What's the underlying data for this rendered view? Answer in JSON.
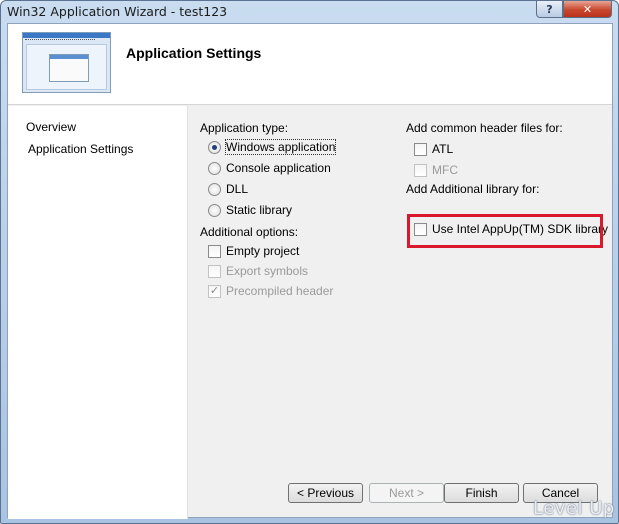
{
  "window": {
    "title": "Win32 Application Wizard - test123",
    "help_label": "?",
    "close_label": "✕"
  },
  "header": {
    "title": "Application Settings"
  },
  "nav": {
    "items": [
      {
        "label": "Overview"
      },
      {
        "label": "Application Settings"
      }
    ]
  },
  "app_type": {
    "heading": "Application type:",
    "options": [
      {
        "label": "Windows application",
        "selected": true
      },
      {
        "label": "Console application",
        "selected": false
      },
      {
        "label": "DLL",
        "selected": false
      },
      {
        "label": "Static library",
        "selected": false
      }
    ]
  },
  "additional_options": {
    "heading": "Additional options:",
    "options": [
      {
        "label": "Empty project",
        "checked": false,
        "enabled": true
      },
      {
        "label": "Export symbols",
        "checked": false,
        "enabled": false
      },
      {
        "label": "Precompiled header",
        "checked": true,
        "enabled": false
      }
    ]
  },
  "header_files": {
    "heading": "Add common header files for:",
    "options": [
      {
        "label": "ATL",
        "checked": false,
        "enabled": true
      },
      {
        "label": "MFC",
        "checked": false,
        "enabled": false
      }
    ]
  },
  "library": {
    "heading": "Add Additional library for:",
    "options": [
      {
        "label": "Use Intel AppUp(TM) SDK library",
        "checked": false,
        "enabled": true
      }
    ]
  },
  "buttons": {
    "previous": "< Previous",
    "next": "Next >",
    "finish": "Finish",
    "cancel": "Cancel"
  },
  "colors": {
    "highlight_box": "#d9182d",
    "window_frame": "#a9c3e2"
  },
  "watermark": "Level Up"
}
